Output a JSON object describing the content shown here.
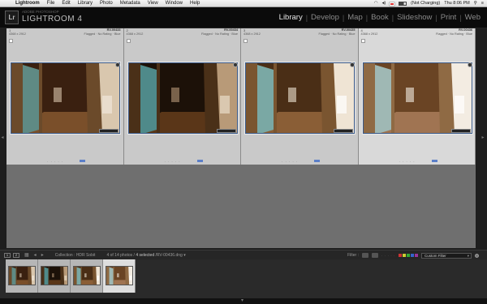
{
  "menubar": {
    "apple": "",
    "items": [
      "Lightroom",
      "File",
      "Edit",
      "Library",
      "Photo",
      "Metadata",
      "View",
      "Window",
      "Help"
    ],
    "status": "(Not Charging)",
    "clock": "Thu 8:06 PM"
  },
  "header": {
    "logo": "Lr",
    "subtitle": "ADOBE PHOTOSHOP",
    "title": "LIGHTROOM 4",
    "modules": [
      "Library",
      "Develop",
      "Map",
      "Book",
      "Slideshow",
      "Print",
      "Web"
    ],
    "active_module": "Library"
  },
  "grid": [
    {
      "index": "1",
      "filename": "RV-00433",
      "dims": "4368 x 2912",
      "meta": "Flagged · No Rating · Blue",
      "tone": "warm",
      "state": "sel"
    },
    {
      "index": "2",
      "filename": "RV-00434",
      "dims": "4368 x 2912",
      "meta": "Flagged · No Rating · Blue",
      "tone": "dark",
      "state": "sel"
    },
    {
      "index": "3",
      "filename": "RV-00435",
      "dims": "4368 x 2912",
      "meta": "Flagged · No Rating · Blue",
      "tone": "mid",
      "state": "sel"
    },
    {
      "index": "4",
      "filename": "RV-00436",
      "dims": "4368 x 2912",
      "meta": "Flagged · No Rating · Blue",
      "tone": "bright",
      "state": "active"
    }
  ],
  "filmstrip_bar": {
    "page1": "1",
    "page2": "2",
    "collection": "Collection : HDR Sobit",
    "count_prefix": "4 of 14 photos /",
    "selected": "4 selected",
    "current_file": "/RV-00436.dng",
    "filter_label": "Filter :",
    "custom_filter": "Custom Filter"
  },
  "colors": {
    "accent_label": "#5b7fc8",
    "header_bg": "#0b0b0b",
    "grid_bg": "#949494"
  }
}
